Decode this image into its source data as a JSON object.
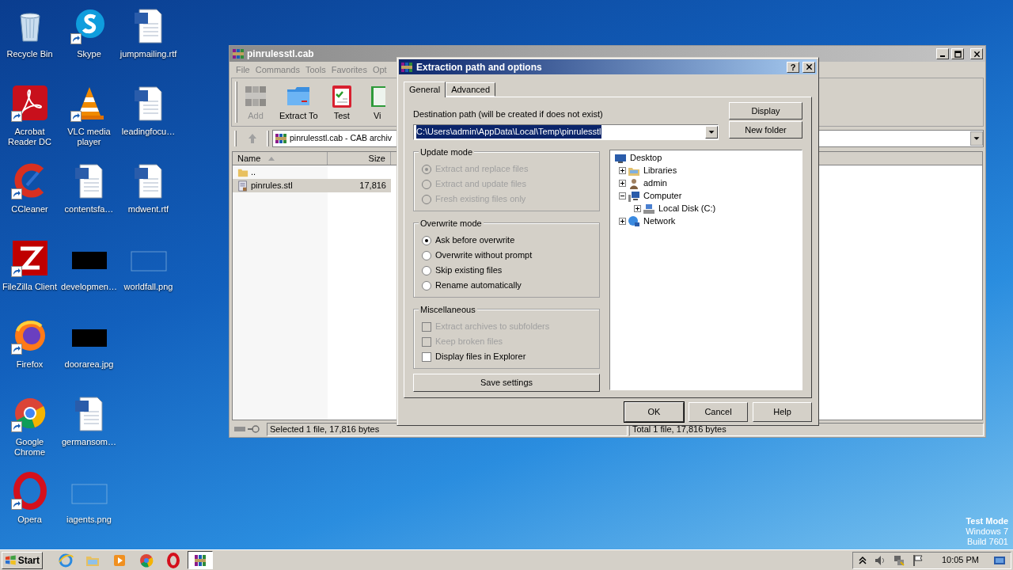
{
  "desktop_icons": [
    {
      "label": "Recycle Bin",
      "kind": "recycle-bin",
      "shortcut": false
    },
    {
      "label": "Acrobat Reader DC",
      "kind": "acrobat",
      "shortcut": true
    },
    {
      "label": "CCleaner",
      "kind": "ccleaner",
      "shortcut": true
    },
    {
      "label": "FileZilla Client",
      "kind": "filezilla",
      "shortcut": true
    },
    {
      "label": "Firefox",
      "kind": "firefox",
      "shortcut": true
    },
    {
      "label": "Google Chrome",
      "kind": "chrome",
      "shortcut": true
    },
    {
      "label": "Opera",
      "kind": "opera",
      "shortcut": true
    },
    {
      "label": "Skype",
      "kind": "skype",
      "shortcut": true
    },
    {
      "label": "VLC media player",
      "kind": "vlc",
      "shortcut": true
    },
    {
      "label": "contentsfa…",
      "kind": "word-document",
      "shortcut": false
    },
    {
      "label": "developmen…",
      "kind": "image-dark",
      "shortcut": false
    },
    {
      "label": "doorarea.jpg",
      "kind": "image-dark",
      "shortcut": false
    },
    {
      "label": "germansom…",
      "kind": "word-document",
      "shortcut": false
    },
    {
      "label": "iagents.png",
      "kind": "image-blank",
      "shortcut": false
    },
    {
      "label": "jumpmailing.rtf",
      "kind": "word-document",
      "shortcut": false
    },
    {
      "label": "leadingfocu…",
      "kind": "word-document",
      "shortcut": false
    },
    {
      "label": "mdwent.rtf",
      "kind": "word-document",
      "shortcut": false
    },
    {
      "label": "worldfall.png",
      "kind": "image-blank",
      "shortcut": false
    }
  ],
  "archive_window": {
    "title": "pinrulesstl.cab",
    "menu": [
      "File",
      "Commands",
      "Tools",
      "Favorites",
      "Opt"
    ],
    "toolbar": [
      {
        "label": "Add",
        "kind": "add",
        "disabled": true
      },
      {
        "label": "Extract To",
        "kind": "extract",
        "disabled": false
      },
      {
        "label": "Test",
        "kind": "test",
        "disabled": false
      },
      {
        "label": "Vi",
        "kind": "view",
        "disabled": false
      }
    ],
    "address": "pinrulesstl.cab - CAB archiv",
    "columns": [
      "Name",
      "Size"
    ],
    "rows": [
      {
        "name": "..",
        "kind": "folder",
        "selected": false
      },
      {
        "name": "pinrules.stl",
        "size": "17,816",
        "kind": "file",
        "selected": true
      }
    ],
    "status_left": "Selected 1 file, 17,816 bytes",
    "status_right": "Total 1 file, 17,816 bytes"
  },
  "dialog": {
    "title": "Extraction path and options",
    "help_button": "?",
    "tabs": [
      {
        "label": "General",
        "selected": true
      },
      {
        "label": "Advanced",
        "selected": false
      }
    ],
    "destination_label": "Destination path (will be created if does not exist)",
    "destination_path": "C:\\Users\\admin\\AppData\\Local\\Temp\\pinrulesstl",
    "path_selected": true,
    "side_buttons": [
      "Display",
      "New folder"
    ],
    "groups": [
      {
        "title": "Update mode",
        "kind": "radio",
        "options": [
          {
            "label": "Extract and replace files",
            "selected": true,
            "disabled": true
          },
          {
            "label": "Extract and update files",
            "selected": false,
            "disabled": true
          },
          {
            "label": "Fresh existing files only",
            "selected": false,
            "disabled": true
          }
        ]
      },
      {
        "title": "Overwrite mode",
        "kind": "radio",
        "options": [
          {
            "label": "Ask before overwrite",
            "selected": true,
            "disabled": false
          },
          {
            "label": "Overwrite without prompt",
            "selected": false,
            "disabled": false
          },
          {
            "label": "Skip existing files",
            "selected": false,
            "disabled": false
          },
          {
            "label": "Rename automatically",
            "selected": false,
            "disabled": false
          }
        ]
      },
      {
        "title": "Miscellaneous",
        "kind": "checkbox",
        "options": [
          {
            "label": "Extract archives to subfolders",
            "checked": false,
            "disabled": true
          },
          {
            "label": "Keep broken files",
            "checked": false,
            "disabled": true
          },
          {
            "label": "Display files in Explorer",
            "checked": false,
            "disabled": false
          }
        ]
      }
    ],
    "save_button": "Save settings",
    "tree": [
      {
        "label": "Desktop",
        "kind": "desktop",
        "children": [
          {
            "label": "Libraries",
            "kind": "libraries",
            "expanded": false
          },
          {
            "label": "admin",
            "kind": "user",
            "expanded": false
          },
          {
            "label": "Computer",
            "kind": "computer",
            "expanded": true,
            "children": [
              {
                "label": "Local Disk (C:)",
                "kind": "drive",
                "expanded": false
              }
            ]
          },
          {
            "label": "Network",
            "kind": "network",
            "expanded": false
          }
        ]
      }
    ],
    "buttons": [
      {
        "label": "OK",
        "default": true
      },
      {
        "label": "Cancel",
        "default": false
      },
      {
        "label": "Help",
        "default": false
      }
    ]
  },
  "desktop_notice": [
    "Test Mode",
    "Windows 7",
    "Build 7601"
  ],
  "taskbar": {
    "start": "Start",
    "items": [
      {
        "kind": "ie",
        "active": false
      },
      {
        "kind": "explorer",
        "active": false
      },
      {
        "kind": "media",
        "active": false
      },
      {
        "kind": "chrome",
        "active": false
      },
      {
        "kind": "opera",
        "active": false
      },
      {
        "kind": "winrar",
        "active": true
      }
    ],
    "tray": [
      {
        "kind": "chevron"
      },
      {
        "kind": "speaker"
      },
      {
        "kind": "network"
      },
      {
        "kind": "flag"
      }
    ],
    "clock": "10:05 PM"
  }
}
